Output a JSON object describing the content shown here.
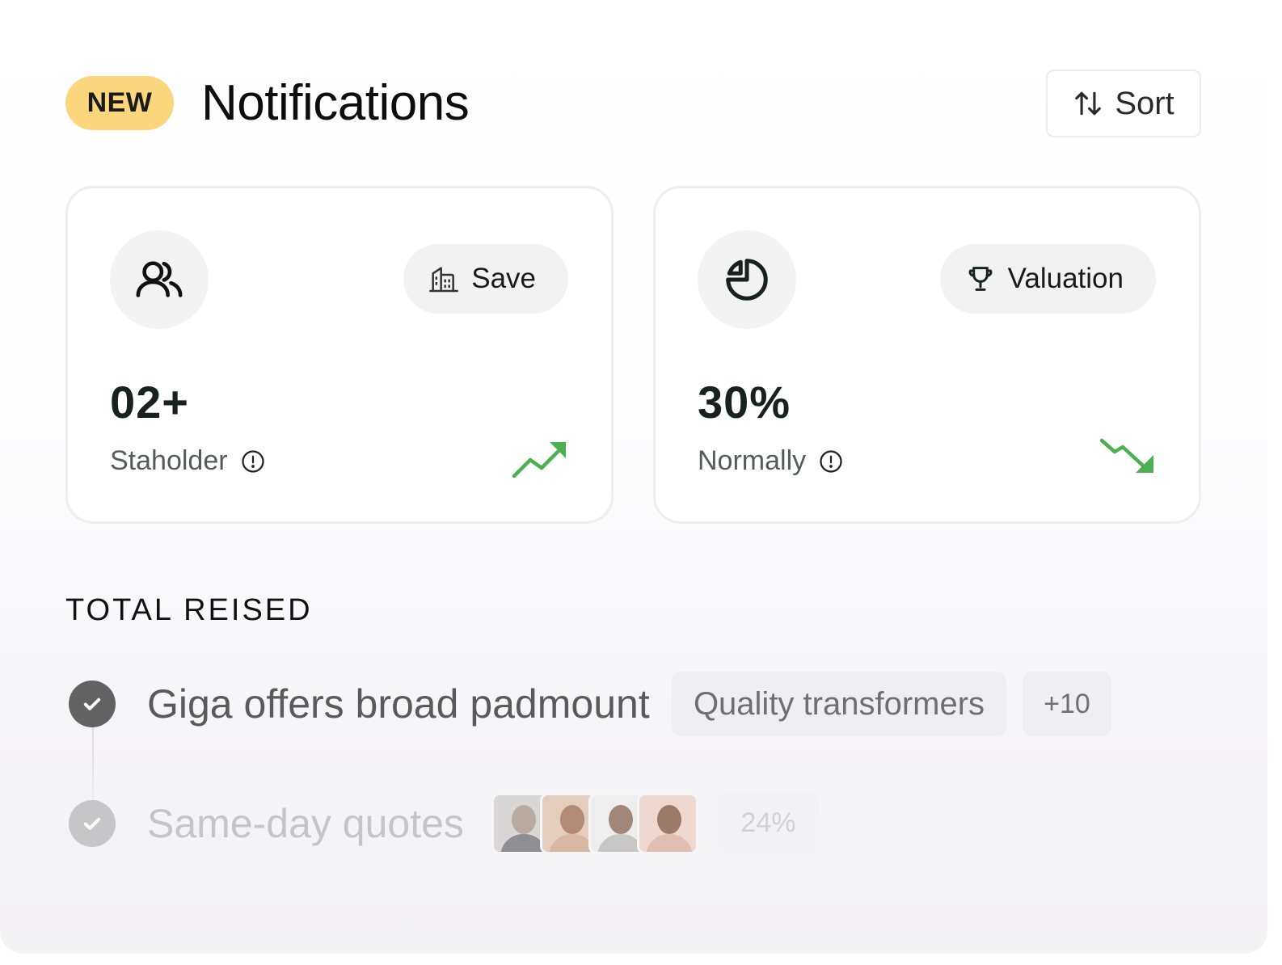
{
  "header": {
    "badge": "NEW",
    "title": "Notifications",
    "sort_label": "Sort",
    "sort_icon": "sort-arrows-icon"
  },
  "cards": [
    {
      "icon": "users-icon",
      "button_label": "Save",
      "button_icon": "building-icon",
      "value": "02+",
      "label": "Staholder",
      "info_icon": "info-icon",
      "trend": "up",
      "trend_color": "#4caf50"
    },
    {
      "icon": "pie-chart-icon",
      "button_label": "Valuation",
      "button_icon": "trophy-icon",
      "value": "30%",
      "label": "Normally",
      "info_icon": "info-icon",
      "trend": "down",
      "trend_color": "#4caf50"
    }
  ],
  "section": {
    "heading": "TOTAL REISED",
    "items": [
      {
        "title": "Giga offers broad padmount",
        "tags": [
          "Quality transformers",
          "+10"
        ],
        "status": "checked"
      },
      {
        "title": "Same-day quotes",
        "avatars": [
          "avatar-man-glasses",
          "avatar-woman-curly",
          "avatar-man-beard",
          "avatar-woman-smiling"
        ],
        "percent": "24%",
        "status": "checked"
      }
    ]
  },
  "colors": {
    "badge_bg": "#fcd67c",
    "trend_green": "#4caf50",
    "text_dark": "#17221f"
  }
}
